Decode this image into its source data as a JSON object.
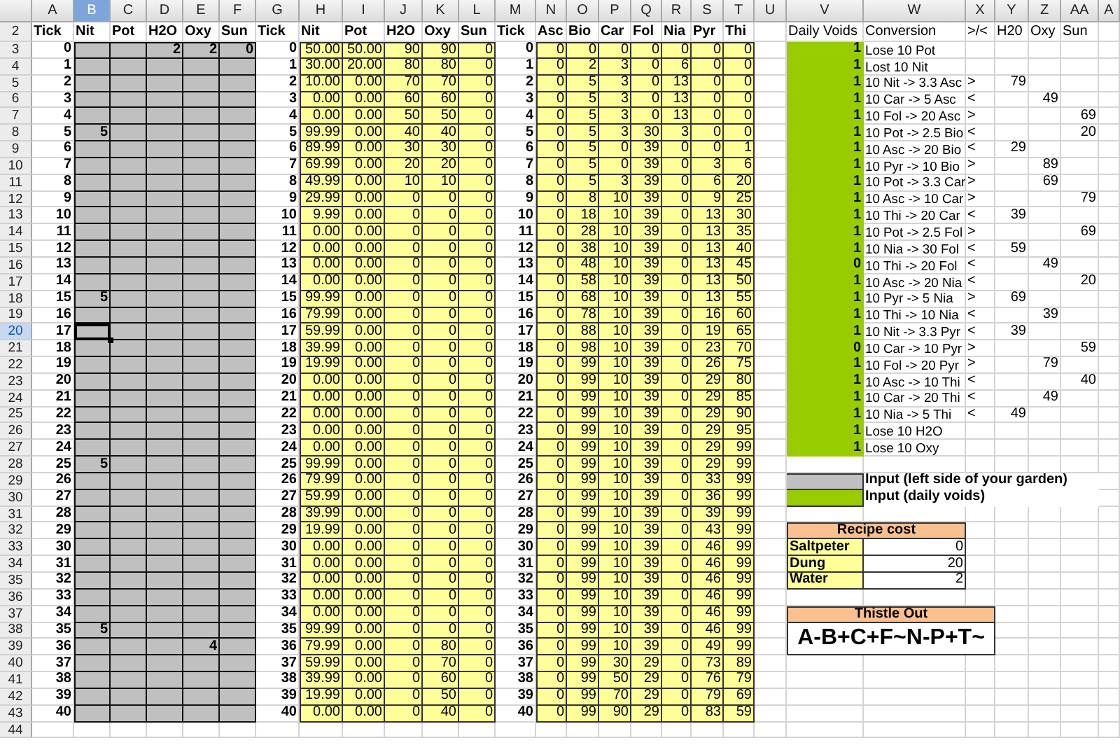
{
  "column_letters": [
    {
      "label": "A",
      "selected": false
    },
    {
      "label": "B",
      "selected": true
    },
    {
      "label": "C",
      "selected": false
    },
    {
      "label": "D",
      "selected": false
    },
    {
      "label": "E",
      "selected": false
    },
    {
      "label": "F",
      "selected": false
    },
    {
      "label": "G",
      "selected": false
    },
    {
      "label": "H",
      "selected": false
    },
    {
      "label": "I",
      "selected": false
    },
    {
      "label": "J",
      "selected": false
    },
    {
      "label": "K",
      "selected": false
    },
    {
      "label": "L",
      "selected": false
    },
    {
      "label": "M",
      "selected": false
    },
    {
      "label": "N",
      "selected": false
    },
    {
      "label": "O",
      "selected": false
    },
    {
      "label": "P",
      "selected": false
    },
    {
      "label": "Q",
      "selected": false
    },
    {
      "label": "R",
      "selected": false
    },
    {
      "label": "S",
      "selected": false
    },
    {
      "label": "T",
      "selected": false
    },
    {
      "label": "U",
      "selected": false
    },
    {
      "label": "V",
      "selected": false
    },
    {
      "label": "W",
      "selected": false
    },
    {
      "label": "X",
      "selected": false
    },
    {
      "label": "Y",
      "selected": false
    },
    {
      "label": "Z",
      "selected": false
    },
    {
      "label": "AA",
      "selected": false
    },
    {
      "label": "A",
      "selected": false
    }
  ],
  "row_numbers": [
    {
      "label": "2",
      "selected": false
    },
    {
      "label": "3",
      "selected": false
    },
    {
      "label": "4",
      "selected": false
    },
    {
      "label": "5",
      "selected": false
    },
    {
      "label": "6",
      "selected": false
    },
    {
      "label": "7",
      "selected": false
    },
    {
      "label": "8",
      "selected": false
    },
    {
      "label": "9",
      "selected": false
    },
    {
      "label": "10",
      "selected": false
    },
    {
      "label": "11",
      "selected": false
    },
    {
      "label": "12",
      "selected": false
    },
    {
      "label": "13",
      "selected": false
    },
    {
      "label": "14",
      "selected": false
    },
    {
      "label": "15",
      "selected": false
    },
    {
      "label": "16",
      "selected": false
    },
    {
      "label": "17",
      "selected": false
    },
    {
      "label": "18",
      "selected": false
    },
    {
      "label": "19",
      "selected": false
    },
    {
      "label": "20",
      "selected": true
    },
    {
      "label": "21",
      "selected": false
    },
    {
      "label": "22",
      "selected": false
    },
    {
      "label": "23",
      "selected": false
    },
    {
      "label": "24",
      "selected": false
    },
    {
      "label": "25",
      "selected": false
    },
    {
      "label": "26",
      "selected": false
    },
    {
      "label": "27",
      "selected": false
    },
    {
      "label": "28",
      "selected": false
    },
    {
      "label": "29",
      "selected": false
    },
    {
      "label": "30",
      "selected": false
    },
    {
      "label": "31",
      "selected": false
    },
    {
      "label": "32",
      "selected": false
    },
    {
      "label": "33",
      "selected": false
    },
    {
      "label": "34",
      "selected": false
    },
    {
      "label": "35",
      "selected": false
    },
    {
      "label": "36",
      "selected": false
    },
    {
      "label": "37",
      "selected": false
    },
    {
      "label": "38",
      "selected": false
    },
    {
      "label": "39",
      "selected": false
    },
    {
      "label": "40",
      "selected": false
    },
    {
      "label": "41",
      "selected": false
    },
    {
      "label": "42",
      "selected": false
    },
    {
      "label": "43",
      "selected": false
    },
    {
      "label": "44",
      "selected": false
    }
  ],
  "input_grid": {
    "headers": [
      "Tick",
      "Nit",
      "Pot",
      "H2O",
      "Oxy",
      "Sun"
    ],
    "rows": [
      [
        "0",
        "",
        "",
        "2",
        "2",
        "0"
      ],
      [
        "1",
        "",
        "",
        "",
        "",
        ""
      ],
      [
        "2",
        "",
        "",
        "",
        "",
        ""
      ],
      [
        "3",
        "",
        "",
        "",
        "",
        ""
      ],
      [
        "4",
        "",
        "",
        "",
        "",
        ""
      ],
      [
        "5",
        "5",
        "",
        "",
        "",
        ""
      ],
      [
        "6",
        "",
        "",
        "",
        "",
        ""
      ],
      [
        "7",
        "",
        "",
        "",
        "",
        ""
      ],
      [
        "8",
        "",
        "",
        "",
        "",
        ""
      ],
      [
        "9",
        "",
        "",
        "",
        "",
        ""
      ],
      [
        "10",
        "",
        "",
        "",
        "",
        ""
      ],
      [
        "11",
        "",
        "",
        "",
        "",
        ""
      ],
      [
        "12",
        "",
        "",
        "",
        "",
        ""
      ],
      [
        "13",
        "",
        "",
        "",
        "",
        ""
      ],
      [
        "14",
        "",
        "",
        "",
        "",
        ""
      ],
      [
        "15",
        "5",
        "",
        "",
        "",
        ""
      ],
      [
        "16",
        "",
        "",
        "",
        "",
        ""
      ],
      [
        "17",
        "",
        "",
        "",
        "",
        ""
      ],
      [
        "18",
        "",
        "",
        "",
        "",
        ""
      ],
      [
        "19",
        "",
        "",
        "",
        "",
        ""
      ],
      [
        "20",
        "",
        "",
        "",
        "",
        ""
      ],
      [
        "21",
        "",
        "",
        "",
        "",
        ""
      ],
      [
        "22",
        "",
        "",
        "",
        "",
        ""
      ],
      [
        "23",
        "",
        "",
        "",
        "",
        ""
      ],
      [
        "24",
        "",
        "",
        "",
        "",
        ""
      ],
      [
        "25",
        "5",
        "",
        "",
        "",
        ""
      ],
      [
        "26",
        "",
        "",
        "",
        "",
        ""
      ],
      [
        "27",
        "",
        "",
        "",
        "",
        ""
      ],
      [
        "28",
        "",
        "",
        "",
        "",
        ""
      ],
      [
        "29",
        "",
        "",
        "",
        "",
        ""
      ],
      [
        "30",
        "",
        "",
        "",
        "",
        ""
      ],
      [
        "31",
        "",
        "",
        "",
        "",
        ""
      ],
      [
        "32",
        "",
        "",
        "",
        "",
        ""
      ],
      [
        "33",
        "",
        "",
        "",
        "",
        ""
      ],
      [
        "34",
        "",
        "",
        "",
        "",
        ""
      ],
      [
        "35",
        "5",
        "",
        "",
        "",
        ""
      ],
      [
        "36",
        "",
        "",
        "",
        "4",
        ""
      ],
      [
        "37",
        "",
        "",
        "",
        "",
        ""
      ],
      [
        "38",
        "",
        "",
        "",
        "",
        ""
      ],
      [
        "39",
        "",
        "",
        "",
        "",
        ""
      ],
      [
        "40",
        "",
        "",
        "",
        "",
        ""
      ]
    ]
  },
  "simulation": {
    "headers": [
      "Tick",
      "Nit",
      "Pot",
      "H2O",
      "Oxy",
      "Sun"
    ],
    "rows": [
      [
        "0",
        "50.00",
        "50.00",
        "90",
        "90",
        "0"
      ],
      [
        "1",
        "30.00",
        "20.00",
        "80",
        "80",
        "0"
      ],
      [
        "2",
        "10.00",
        "0.00",
        "70",
        "70",
        "0"
      ],
      [
        "3",
        "0.00",
        "0.00",
        "60",
        "60",
        "0"
      ],
      [
        "4",
        "0.00",
        "0.00",
        "50",
        "50",
        "0"
      ],
      [
        "5",
        "99.99",
        "0.00",
        "40",
        "40",
        "0"
      ],
      [
        "6",
        "89.99",
        "0.00",
        "30",
        "30",
        "0"
      ],
      [
        "7",
        "69.99",
        "0.00",
        "20",
        "20",
        "0"
      ],
      [
        "8",
        "49.99",
        "0.00",
        "10",
        "10",
        "0"
      ],
      [
        "9",
        "29.99",
        "0.00",
        "0",
        "0",
        "0"
      ],
      [
        "10",
        "9.99",
        "0.00",
        "0",
        "0",
        "0"
      ],
      [
        "11",
        "0.00",
        "0.00",
        "0",
        "0",
        "0"
      ],
      [
        "12",
        "0.00",
        "0.00",
        "0",
        "0",
        "0"
      ],
      [
        "13",
        "0.00",
        "0.00",
        "0",
        "0",
        "0"
      ],
      [
        "14",
        "0.00",
        "0.00",
        "0",
        "0",
        "0"
      ],
      [
        "15",
        "99.99",
        "0.00",
        "0",
        "0",
        "0"
      ],
      [
        "16",
        "79.99",
        "0.00",
        "0",
        "0",
        "0"
      ],
      [
        "17",
        "59.99",
        "0.00",
        "0",
        "0",
        "0"
      ],
      [
        "18",
        "39.99",
        "0.00",
        "0",
        "0",
        "0"
      ],
      [
        "19",
        "19.99",
        "0.00",
        "0",
        "0",
        "0"
      ],
      [
        "20",
        "0.00",
        "0.00",
        "0",
        "0",
        "0"
      ],
      [
        "21",
        "0.00",
        "0.00",
        "0",
        "0",
        "0"
      ],
      [
        "22",
        "0.00",
        "0.00",
        "0",
        "0",
        "0"
      ],
      [
        "23",
        "0.00",
        "0.00",
        "0",
        "0",
        "0"
      ],
      [
        "24",
        "0.00",
        "0.00",
        "0",
        "0",
        "0"
      ],
      [
        "25",
        "99.99",
        "0.00",
        "0",
        "0",
        "0"
      ],
      [
        "26",
        "79.99",
        "0.00",
        "0",
        "0",
        "0"
      ],
      [
        "27",
        "59.99",
        "0.00",
        "0",
        "0",
        "0"
      ],
      [
        "28",
        "39.99",
        "0.00",
        "0",
        "0",
        "0"
      ],
      [
        "29",
        "19.99",
        "0.00",
        "0",
        "0",
        "0"
      ],
      [
        "30",
        "0.00",
        "0.00",
        "0",
        "0",
        "0"
      ],
      [
        "31",
        "0.00",
        "0.00",
        "0",
        "0",
        "0"
      ],
      [
        "32",
        "0.00",
        "0.00",
        "0",
        "0",
        "0"
      ],
      [
        "33",
        "0.00",
        "0.00",
        "0",
        "0",
        "0"
      ],
      [
        "34",
        "0.00",
        "0.00",
        "0",
        "0",
        "0"
      ],
      [
        "35",
        "99.99",
        "0.00",
        "0",
        "0",
        "0"
      ],
      [
        "36",
        "79.99",
        "0.00",
        "0",
        "80",
        "0"
      ],
      [
        "37",
        "59.99",
        "0.00",
        "0",
        "70",
        "0"
      ],
      [
        "38",
        "39.99",
        "0.00",
        "0",
        "60",
        "0"
      ],
      [
        "39",
        "19.99",
        "0.00",
        "0",
        "50",
        "0"
      ],
      [
        "40",
        "0.00",
        "0.00",
        "0",
        "40",
        "0"
      ]
    ]
  },
  "products": {
    "headers": [
      "Tick",
      "Asc",
      "Bio",
      "Car",
      "Fol",
      "Nia",
      "Pyr",
      "Thi"
    ],
    "rows": [
      [
        "0",
        "0",
        "0",
        "0",
        "0",
        "0",
        "0",
        "0"
      ],
      [
        "1",
        "0",
        "2",
        "3",
        "0",
        "6",
        "0",
        "0"
      ],
      [
        "2",
        "0",
        "5",
        "3",
        "0",
        "13",
        "0",
        "0"
      ],
      [
        "3",
        "0",
        "5",
        "3",
        "0",
        "13",
        "0",
        "0"
      ],
      [
        "4",
        "0",
        "5",
        "3",
        "0",
        "13",
        "0",
        "0"
      ],
      [
        "5",
        "0",
        "5",
        "3",
        "30",
        "3",
        "0",
        "0"
      ],
      [
        "6",
        "0",
        "5",
        "0",
        "39",
        "0",
        "0",
        "1"
      ],
      [
        "7",
        "0",
        "5",
        "0",
        "39",
        "0",
        "3",
        "6"
      ],
      [
        "8",
        "0",
        "5",
        "3",
        "39",
        "0",
        "6",
        "20"
      ],
      [
        "9",
        "0",
        "8",
        "10",
        "39",
        "0",
        "9",
        "25"
      ],
      [
        "10",
        "0",
        "18",
        "10",
        "39",
        "0",
        "13",
        "30"
      ],
      [
        "11",
        "0",
        "28",
        "10",
        "39",
        "0",
        "13",
        "35"
      ],
      [
        "12",
        "0",
        "38",
        "10",
        "39",
        "0",
        "13",
        "40"
      ],
      [
        "13",
        "0",
        "48",
        "10",
        "39",
        "0",
        "13",
        "45"
      ],
      [
        "14",
        "0",
        "58",
        "10",
        "39",
        "0",
        "13",
        "50"
      ],
      [
        "15",
        "0",
        "68",
        "10",
        "39",
        "0",
        "13",
        "55"
      ],
      [
        "16",
        "0",
        "78",
        "10",
        "39",
        "0",
        "16",
        "60"
      ],
      [
        "17",
        "0",
        "88",
        "10",
        "39",
        "0",
        "19",
        "65"
      ],
      [
        "18",
        "0",
        "98",
        "10",
        "39",
        "0",
        "23",
        "70"
      ],
      [
        "19",
        "0",
        "99",
        "10",
        "39",
        "0",
        "26",
        "75"
      ],
      [
        "20",
        "0",
        "99",
        "10",
        "39",
        "0",
        "29",
        "80"
      ],
      [
        "21",
        "0",
        "99",
        "10",
        "39",
        "0",
        "29",
        "85"
      ],
      [
        "22",
        "0",
        "99",
        "10",
        "39",
        "0",
        "29",
        "90"
      ],
      [
        "23",
        "0",
        "99",
        "10",
        "39",
        "0",
        "29",
        "95"
      ],
      [
        "24",
        "0",
        "99",
        "10",
        "39",
        "0",
        "29",
        "99"
      ],
      [
        "25",
        "0",
        "99",
        "10",
        "39",
        "0",
        "29",
        "99"
      ],
      [
        "26",
        "0",
        "99",
        "10",
        "39",
        "0",
        "33",
        "99"
      ],
      [
        "27",
        "0",
        "99",
        "10",
        "39",
        "0",
        "36",
        "99"
      ],
      [
        "28",
        "0",
        "99",
        "10",
        "39",
        "0",
        "39",
        "99"
      ],
      [
        "29",
        "0",
        "99",
        "10",
        "39",
        "0",
        "43",
        "99"
      ],
      [
        "30",
        "0",
        "99",
        "10",
        "39",
        "0",
        "46",
        "99"
      ],
      [
        "31",
        "0",
        "99",
        "10",
        "39",
        "0",
        "46",
        "99"
      ],
      [
        "32",
        "0",
        "99",
        "10",
        "39",
        "0",
        "46",
        "99"
      ],
      [
        "33",
        "0",
        "99",
        "10",
        "39",
        "0",
        "46",
        "99"
      ],
      [
        "34",
        "0",
        "99",
        "10",
        "39",
        "0",
        "46",
        "99"
      ],
      [
        "35",
        "0",
        "99",
        "10",
        "39",
        "0",
        "46",
        "99"
      ],
      [
        "36",
        "0",
        "99",
        "10",
        "39",
        "0",
        "49",
        "99"
      ],
      [
        "37",
        "0",
        "99",
        "30",
        "29",
        "0",
        "73",
        "89"
      ],
      [
        "38",
        "0",
        "99",
        "50",
        "29",
        "0",
        "76",
        "79"
      ],
      [
        "39",
        "0",
        "99",
        "70",
        "29",
        "0",
        "79",
        "69"
      ],
      [
        "40",
        "0",
        "99",
        "90",
        "29",
        "0",
        "83",
        "59"
      ]
    ]
  },
  "conversions": {
    "headers": [
      "Daily Voids",
      "Conversion",
      ">/<",
      "H20",
      "Oxy",
      "Sun"
    ],
    "rows": [
      [
        "1",
        "Lose 10 Pot",
        "",
        "",
        "",
        ""
      ],
      [
        "1",
        "Lost 10 Nit",
        "",
        "",
        "",
        ""
      ],
      [
        "1",
        "10 Nit -> 3.3 Asc",
        ">",
        "79",
        "",
        ""
      ],
      [
        "1",
        "10 Car -> 5 Asc",
        "<",
        "",
        "49",
        ""
      ],
      [
        "1",
        "10 Fol -> 20 Asc",
        ">",
        "",
        "",
        "69"
      ],
      [
        "1",
        "10 Pot -> 2.5 Bio",
        "<",
        "",
        "",
        "20"
      ],
      [
        "1",
        "10 Asc -> 20 Bio",
        "<",
        "29",
        "",
        ""
      ],
      [
        "1",
        "10 Pyr -> 10 Bio",
        ">",
        "",
        "89",
        ""
      ],
      [
        "1",
        "10 Pot -> 3.3 Car",
        ">",
        "",
        "69",
        ""
      ],
      [
        "1",
        "10 Asc -> 10 Car",
        ">",
        "",
        "",
        "79"
      ],
      [
        "1",
        "10 Thi -> 20 Car",
        "<",
        "39",
        "",
        ""
      ],
      [
        "1",
        "10 Pot -> 2.5 Fol",
        ">",
        "",
        "",
        "69"
      ],
      [
        "1",
        "10 Nia -> 30 Fol",
        "<",
        "59",
        "",
        ""
      ],
      [
        "0",
        "10 Thi -> 20 Fol",
        "<",
        "",
        "49",
        ""
      ],
      [
        "1",
        "10 Asc -> 20 Nia",
        "<",
        "",
        "",
        "20"
      ],
      [
        "1",
        "10 Pyr -> 5 Nia",
        ">",
        "69",
        "",
        ""
      ],
      [
        "1",
        "10 Thi -> 10 Nia",
        "<",
        "",
        "39",
        ""
      ],
      [
        "1",
        "10 Nit -> 3.3 Pyr",
        "<",
        "39",
        "",
        ""
      ],
      [
        "0",
        "10 Car -> 10 Pyr",
        ">",
        "",
        "",
        "59"
      ],
      [
        "1",
        "10 Fol -> 20 Pyr",
        ">",
        "",
        "79",
        ""
      ],
      [
        "1",
        "10 Asc -> 10 Thi",
        "<",
        "",
        "",
        "40"
      ],
      [
        "1",
        "10 Car -> 20 Thi",
        "<",
        "",
        "49",
        ""
      ],
      [
        "1",
        "10 Nia -> 5 Thi",
        "<",
        "49",
        "",
        ""
      ],
      [
        "1",
        "Lose 10 H2O",
        "",
        "",
        "",
        ""
      ],
      [
        "1",
        "Lose 10 Oxy",
        "",
        "",
        "",
        ""
      ]
    ]
  },
  "legend": [
    {
      "label": "Input (left side of your garden)",
      "kind": "garden"
    },
    {
      "label": "Input (daily voids)",
      "kind": "voids"
    }
  ],
  "recipe_cost": {
    "title": "Recipe cost",
    "rows": [
      [
        "Saltpeter",
        "0"
      ],
      [
        "Dung",
        "20"
      ],
      [
        "Water",
        "2"
      ]
    ]
  },
  "thistle_out": {
    "title": "Thistle Out",
    "formula": "A-B+C+F~N-P+T~"
  }
}
